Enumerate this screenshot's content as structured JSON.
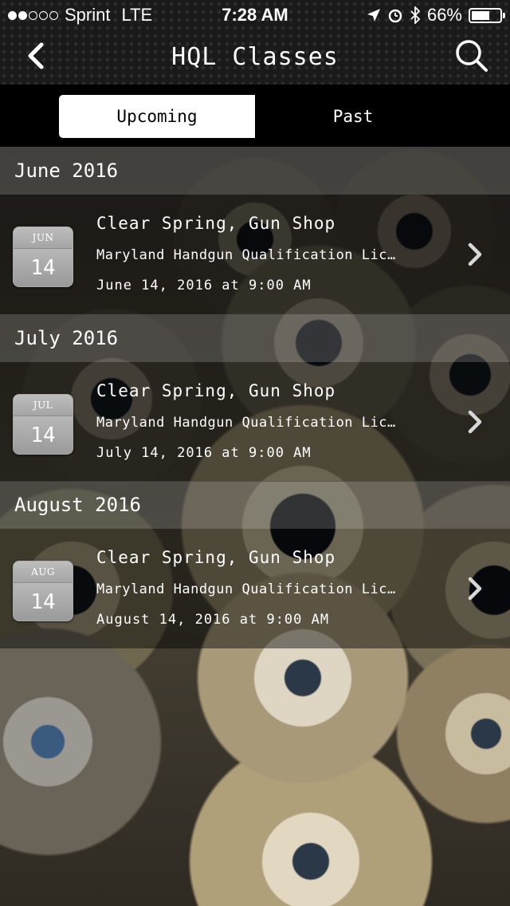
{
  "status_bar": {
    "signal_full": 2,
    "signal_empty": 3,
    "carrier": "Sprint",
    "network": "LTE",
    "time": "7:28 AM",
    "icons": [
      "location-arrow-icon",
      "alarm-icon",
      "bluetooth-icon"
    ],
    "battery": "66%",
    "battery_level": 0.66
  },
  "header": {
    "back_icon": "chevron-left-icon",
    "title": "HQL Classes",
    "search_icon": "search-icon"
  },
  "segments": [
    {
      "label": "Upcoming",
      "selected": true
    },
    {
      "label": "Past",
      "selected": false
    }
  ],
  "sections": [
    {
      "header": "June 2016",
      "events": [
        {
          "month": "JUN",
          "day": "14",
          "title": "Clear Spring, Gun Shop",
          "subtitle": "Maryland Handgun Qualification License",
          "date": "June 14, 2016 at 9:00 AM"
        }
      ]
    },
    {
      "header": "July 2016",
      "events": [
        {
          "month": "JUL",
          "day": "14",
          "title": "Clear Spring, Gun Shop",
          "subtitle": "Maryland Handgun Qualification License",
          "date": "July 14, 2016 at 9:00 AM"
        }
      ]
    },
    {
      "header": "August 2016",
      "events": [
        {
          "month": "AUG",
          "day": "14",
          "title": "Clear Spring, Gun Shop",
          "subtitle": "Maryland Handgun Qualification License",
          "date": "August 14, 2016 at 9:00 AM"
        }
      ]
    }
  ],
  "colors": {
    "segment_active_bg": "#ffffff",
    "bar_bg": "#000000",
    "text": "#ffffff"
  }
}
